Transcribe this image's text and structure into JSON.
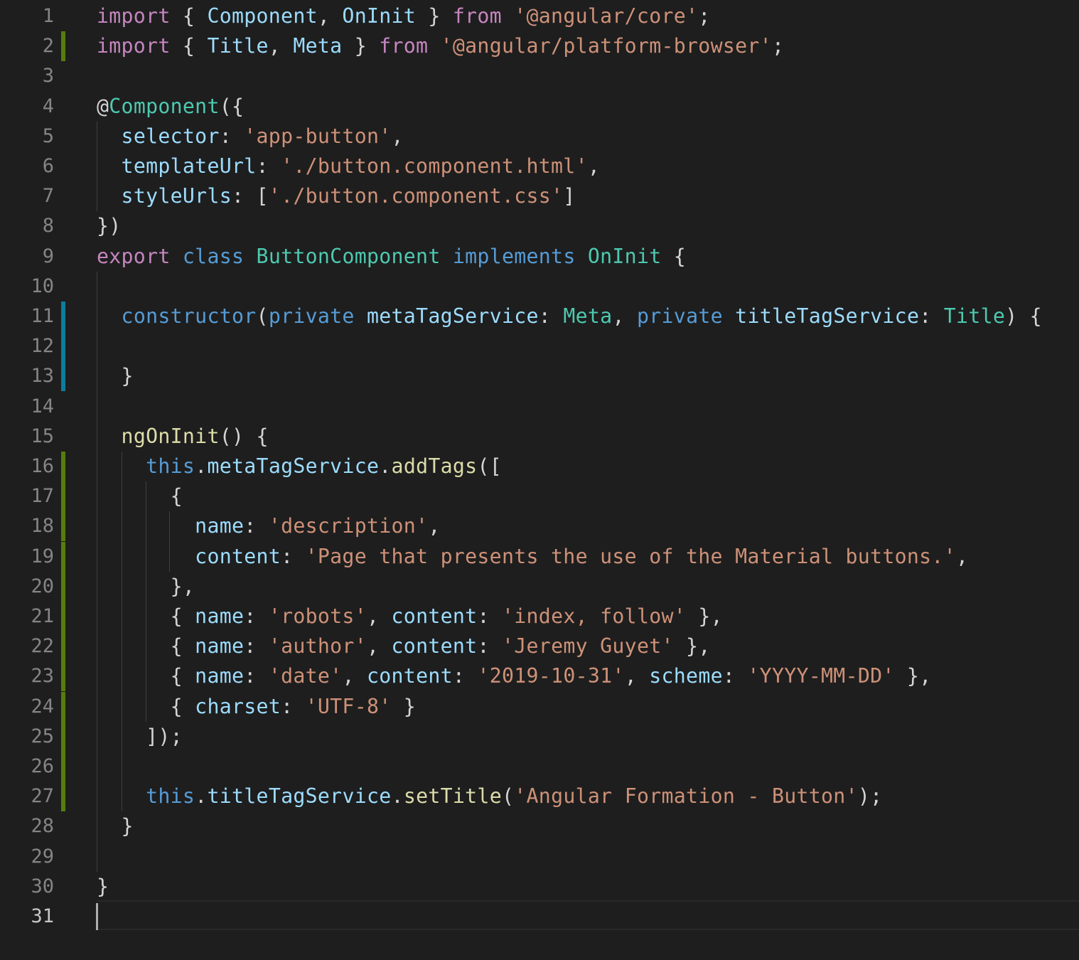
{
  "editor": {
    "language": "typescript",
    "theme": "dark",
    "active_line": 31,
    "lines": [
      {
        "n": "1",
        "tokens": [
          [
            "kw",
            "import"
          ],
          [
            "pn",
            " { "
          ],
          [
            "id",
            "Component"
          ],
          [
            "pn",
            ", "
          ],
          [
            "id",
            "OnInit"
          ],
          [
            "pn",
            " } "
          ],
          [
            "kw",
            "from"
          ],
          [
            "pn",
            " "
          ],
          [
            "st",
            "'@angular/core'"
          ],
          [
            "pn",
            ";"
          ]
        ]
      },
      {
        "n": "2",
        "tokens": [
          [
            "kw",
            "import"
          ],
          [
            "pn",
            " { "
          ],
          [
            "id",
            "Title"
          ],
          [
            "pn",
            ", "
          ],
          [
            "id",
            "Meta"
          ],
          [
            "pn",
            " } "
          ],
          [
            "kw",
            "from"
          ],
          [
            "pn",
            " "
          ],
          [
            "st",
            "'@angular/platform-browser'"
          ],
          [
            "pn",
            ";"
          ]
        ]
      },
      {
        "n": "3",
        "tokens": []
      },
      {
        "n": "4",
        "tokens": [
          [
            "pn",
            "@"
          ],
          [
            "ty",
            "Component"
          ],
          [
            "pn",
            "({"
          ]
        ]
      },
      {
        "n": "5",
        "tokens": [
          [
            "pn",
            "  "
          ],
          [
            "id",
            "selector"
          ],
          [
            "pn",
            ": "
          ],
          [
            "st",
            "'app-button'"
          ],
          [
            "pn",
            ","
          ]
        ]
      },
      {
        "n": "6",
        "tokens": [
          [
            "pn",
            "  "
          ],
          [
            "id",
            "templateUrl"
          ],
          [
            "pn",
            ": "
          ],
          [
            "st",
            "'./button.component.html'"
          ],
          [
            "pn",
            ","
          ]
        ]
      },
      {
        "n": "7",
        "tokens": [
          [
            "pn",
            "  "
          ],
          [
            "id",
            "styleUrls"
          ],
          [
            "pn",
            ": ["
          ],
          [
            "st",
            "'./button.component.css'"
          ],
          [
            "pn",
            "]"
          ]
        ]
      },
      {
        "n": "8",
        "tokens": [
          [
            "pn",
            "})"
          ]
        ]
      },
      {
        "n": "9",
        "tokens": [
          [
            "kw",
            "export"
          ],
          [
            "pn",
            " "
          ],
          [
            "kw2",
            "class"
          ],
          [
            "pn",
            " "
          ],
          [
            "ty",
            "ButtonComponent"
          ],
          [
            "pn",
            " "
          ],
          [
            "kw2",
            "implements"
          ],
          [
            "pn",
            " "
          ],
          [
            "ty",
            "OnInit"
          ],
          [
            "pn",
            " {"
          ]
        ]
      },
      {
        "n": "10",
        "tokens": []
      },
      {
        "n": "11",
        "tokens": [
          [
            "pn",
            "  "
          ],
          [
            "kw2",
            "constructor"
          ],
          [
            "pn",
            "("
          ],
          [
            "kw2",
            "private"
          ],
          [
            "pn",
            " "
          ],
          [
            "id",
            "metaTagService"
          ],
          [
            "pn",
            ": "
          ],
          [
            "ty",
            "Meta"
          ],
          [
            "pn",
            ", "
          ],
          [
            "kw2",
            "private"
          ],
          [
            "pn",
            " "
          ],
          [
            "id",
            "titleTagService"
          ],
          [
            "pn",
            ": "
          ],
          [
            "ty",
            "Title"
          ],
          [
            "pn",
            ") {"
          ]
        ]
      },
      {
        "n": "12",
        "tokens": []
      },
      {
        "n": "13",
        "tokens": [
          [
            "pn",
            "  }"
          ]
        ]
      },
      {
        "n": "14",
        "tokens": []
      },
      {
        "n": "15",
        "tokens": [
          [
            "pn",
            "  "
          ],
          [
            "fn",
            "ngOnInit"
          ],
          [
            "pn",
            "() {"
          ]
        ]
      },
      {
        "n": "16",
        "tokens": [
          [
            "pn",
            "    "
          ],
          [
            "kw2",
            "this"
          ],
          [
            "pn",
            "."
          ],
          [
            "id",
            "metaTagService"
          ],
          [
            "pn",
            "."
          ],
          [
            "fn",
            "addTags"
          ],
          [
            "pn",
            "(["
          ]
        ]
      },
      {
        "n": "17",
        "tokens": [
          [
            "pn",
            "      {"
          ]
        ]
      },
      {
        "n": "18",
        "tokens": [
          [
            "pn",
            "        "
          ],
          [
            "id",
            "name"
          ],
          [
            "pn",
            ": "
          ],
          [
            "st",
            "'description'"
          ],
          [
            "pn",
            ","
          ]
        ]
      },
      {
        "n": "19",
        "tokens": [
          [
            "pn",
            "        "
          ],
          [
            "id",
            "content"
          ],
          [
            "pn",
            ": "
          ],
          [
            "st",
            "'Page that presents the use of the Material buttons.'"
          ],
          [
            "pn",
            ","
          ]
        ]
      },
      {
        "n": "20",
        "tokens": [
          [
            "pn",
            "      },"
          ]
        ]
      },
      {
        "n": "21",
        "tokens": [
          [
            "pn",
            "      { "
          ],
          [
            "id",
            "name"
          ],
          [
            "pn",
            ": "
          ],
          [
            "st",
            "'robots'"
          ],
          [
            "pn",
            ", "
          ],
          [
            "id",
            "content"
          ],
          [
            "pn",
            ": "
          ],
          [
            "st",
            "'index, follow'"
          ],
          [
            "pn",
            " },"
          ]
        ]
      },
      {
        "n": "22",
        "tokens": [
          [
            "pn",
            "      { "
          ],
          [
            "id",
            "name"
          ],
          [
            "pn",
            ": "
          ],
          [
            "st",
            "'author'"
          ],
          [
            "pn",
            ", "
          ],
          [
            "id",
            "content"
          ],
          [
            "pn",
            ": "
          ],
          [
            "st",
            "'Jeremy Guyet'"
          ],
          [
            "pn",
            " },"
          ]
        ]
      },
      {
        "n": "23",
        "tokens": [
          [
            "pn",
            "      { "
          ],
          [
            "id",
            "name"
          ],
          [
            "pn",
            ": "
          ],
          [
            "st",
            "'date'"
          ],
          [
            "pn",
            ", "
          ],
          [
            "id",
            "content"
          ],
          [
            "pn",
            ": "
          ],
          [
            "st",
            "'2019-10-31'"
          ],
          [
            "pn",
            ", "
          ],
          [
            "id",
            "scheme"
          ],
          [
            "pn",
            ": "
          ],
          [
            "st",
            "'YYYY-MM-DD'"
          ],
          [
            "pn",
            " },"
          ]
        ]
      },
      {
        "n": "24",
        "tokens": [
          [
            "pn",
            "      { "
          ],
          [
            "id",
            "charset"
          ],
          [
            "pn",
            ": "
          ],
          [
            "st",
            "'UTF-8'"
          ],
          [
            "pn",
            " }"
          ]
        ]
      },
      {
        "n": "25",
        "tokens": [
          [
            "pn",
            "    ]);"
          ]
        ]
      },
      {
        "n": "26",
        "tokens": []
      },
      {
        "n": "27",
        "tokens": [
          [
            "pn",
            "    "
          ],
          [
            "kw2",
            "this"
          ],
          [
            "pn",
            "."
          ],
          [
            "id",
            "titleTagService"
          ],
          [
            "pn",
            "."
          ],
          [
            "fn",
            "setTitle"
          ],
          [
            "pn",
            "("
          ],
          [
            "st",
            "'Angular Formation - Button'"
          ],
          [
            "pn",
            ");"
          ]
        ]
      },
      {
        "n": "28",
        "tokens": [
          [
            "pn",
            "  }"
          ]
        ]
      },
      {
        "n": "29",
        "tokens": []
      },
      {
        "n": "30",
        "tokens": [
          [
            "pn",
            "}"
          ]
        ]
      },
      {
        "n": "31",
        "tokens": []
      }
    ],
    "gutter_marks": [
      {
        "line": 2,
        "kind": "added"
      },
      {
        "line": 11,
        "kind": "modified"
      },
      {
        "line": 12,
        "kind": "modified"
      },
      {
        "line": 13,
        "kind": "modified"
      },
      {
        "line": 16,
        "kind": "added"
      },
      {
        "line": 17,
        "kind": "added"
      },
      {
        "line": 18,
        "kind": "added"
      },
      {
        "line": 19,
        "kind": "added"
      },
      {
        "line": 20,
        "kind": "added"
      },
      {
        "line": 21,
        "kind": "added"
      },
      {
        "line": 22,
        "kind": "added"
      },
      {
        "line": 23,
        "kind": "added"
      },
      {
        "line": 24,
        "kind": "added"
      },
      {
        "line": 25,
        "kind": "added"
      },
      {
        "line": 26,
        "kind": "added"
      },
      {
        "line": 27,
        "kind": "added"
      }
    ]
  }
}
